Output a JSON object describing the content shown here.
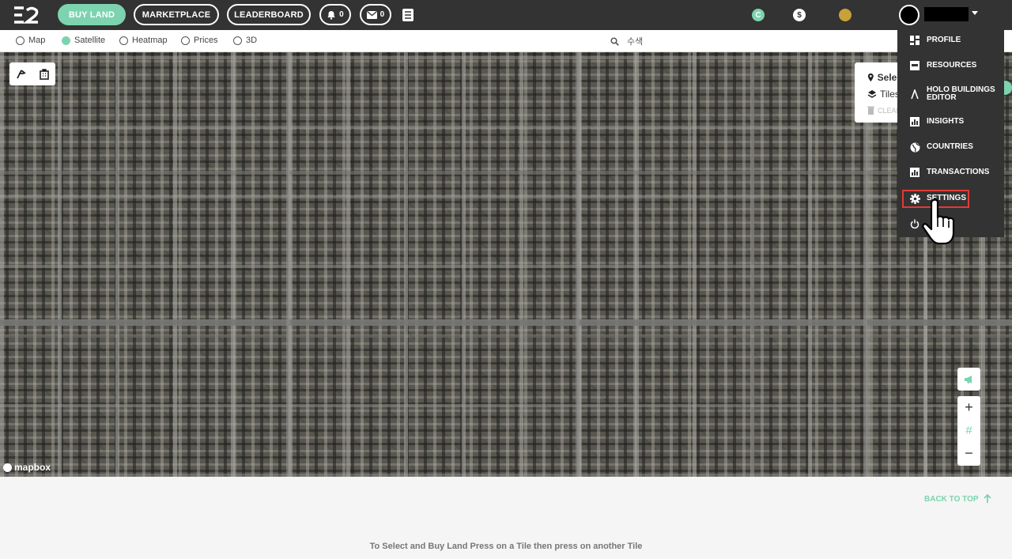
{
  "header": {
    "buy_land": "BUY LAND",
    "marketplace": "MARKETPLACE",
    "leaderboard": "LEADERBOARD",
    "notifications_count": "0",
    "messages_count": "0",
    "coin1_symbol": "C",
    "coin2_symbol": "$",
    "accent_color": "#7dd3b0"
  },
  "map_modes": {
    "map": "Map",
    "satellite": "Satellite",
    "heatmap": "Heatmap",
    "prices": "Prices",
    "three_d": "3D",
    "selected": "Satellite"
  },
  "search": {
    "text": "수색"
  },
  "selection_panel": {
    "select": "Selec",
    "tiles": "Tiles",
    "clear": "CLEAR"
  },
  "map_footer": {
    "attribution": "mapbox"
  },
  "controls": {
    "zoom_in": "+",
    "grid": "#",
    "zoom_out": "−"
  },
  "footer": {
    "back_to_top": "BACK TO TOP",
    "hint": "To Select and Buy Land Press on a Tile then press on another Tile"
  },
  "user_menu": {
    "items": [
      {
        "label": "PROFILE",
        "icon": "dashboard-icon"
      },
      {
        "label": "RESOURCES",
        "icon": "inbox-icon"
      },
      {
        "label": "HOLO BUILDINGS EDITOR",
        "icon": "holo-icon"
      },
      {
        "label": "INSIGHTS",
        "icon": "bar-chart-icon"
      },
      {
        "label": "COUNTRIES",
        "icon": "globe-icon"
      },
      {
        "label": "TRANSACTIONS",
        "icon": "bar-chart-icon"
      },
      {
        "label": "SETTINGS",
        "icon": "gear-icon",
        "highlighted": true
      },
      {
        "label": "",
        "icon": "power-icon"
      }
    ]
  }
}
